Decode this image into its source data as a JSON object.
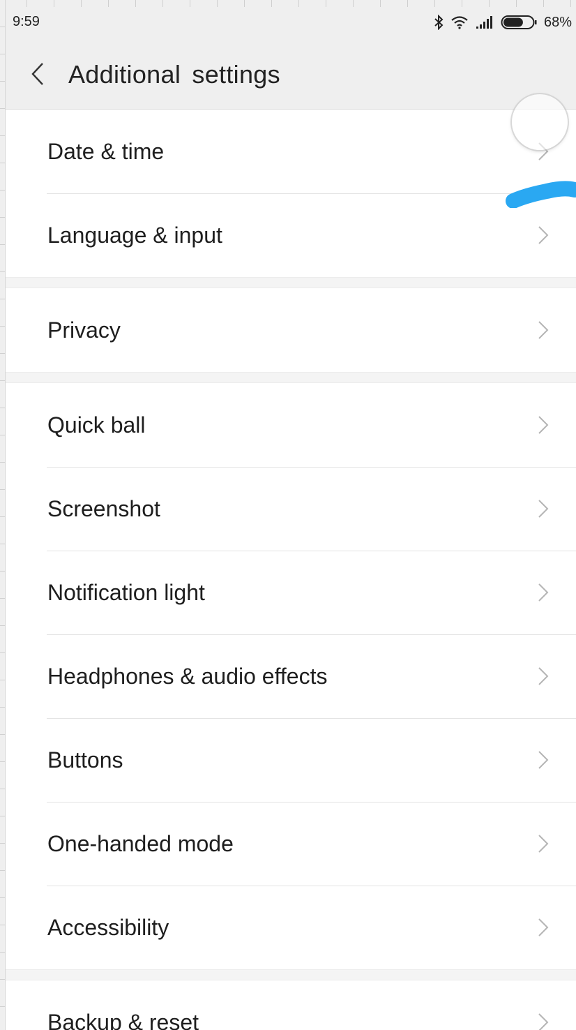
{
  "status_bar": {
    "time": "9:59",
    "battery_percent": "68%",
    "battery_level": 0.68,
    "icons": [
      "bluetooth-icon",
      "wifi-icon",
      "signal-icon",
      "battery-icon"
    ]
  },
  "header": {
    "back_icon": "chevron-left-icon",
    "title": "Additional settings"
  },
  "groups": [
    {
      "items": [
        {
          "label": "Date & time"
        },
        {
          "label": "Language & input"
        }
      ]
    },
    {
      "items": [
        {
          "label": "Privacy"
        }
      ]
    },
    {
      "items": [
        {
          "label": "Quick ball"
        },
        {
          "label": "Screenshot"
        },
        {
          "label": "Notification light"
        },
        {
          "label": "Headphones & audio effects"
        },
        {
          "label": "Buttons"
        },
        {
          "label": "One-handed mode"
        },
        {
          "label": "Accessibility"
        }
      ]
    },
    {
      "items": [
        {
          "label": "Backup & reset"
        }
      ]
    }
  ],
  "colors": {
    "background": "#f4f4f4",
    "row_background": "#ffffff",
    "chevron": "#b5b5b5",
    "touch_stroke": "#2aa8f2"
  }
}
